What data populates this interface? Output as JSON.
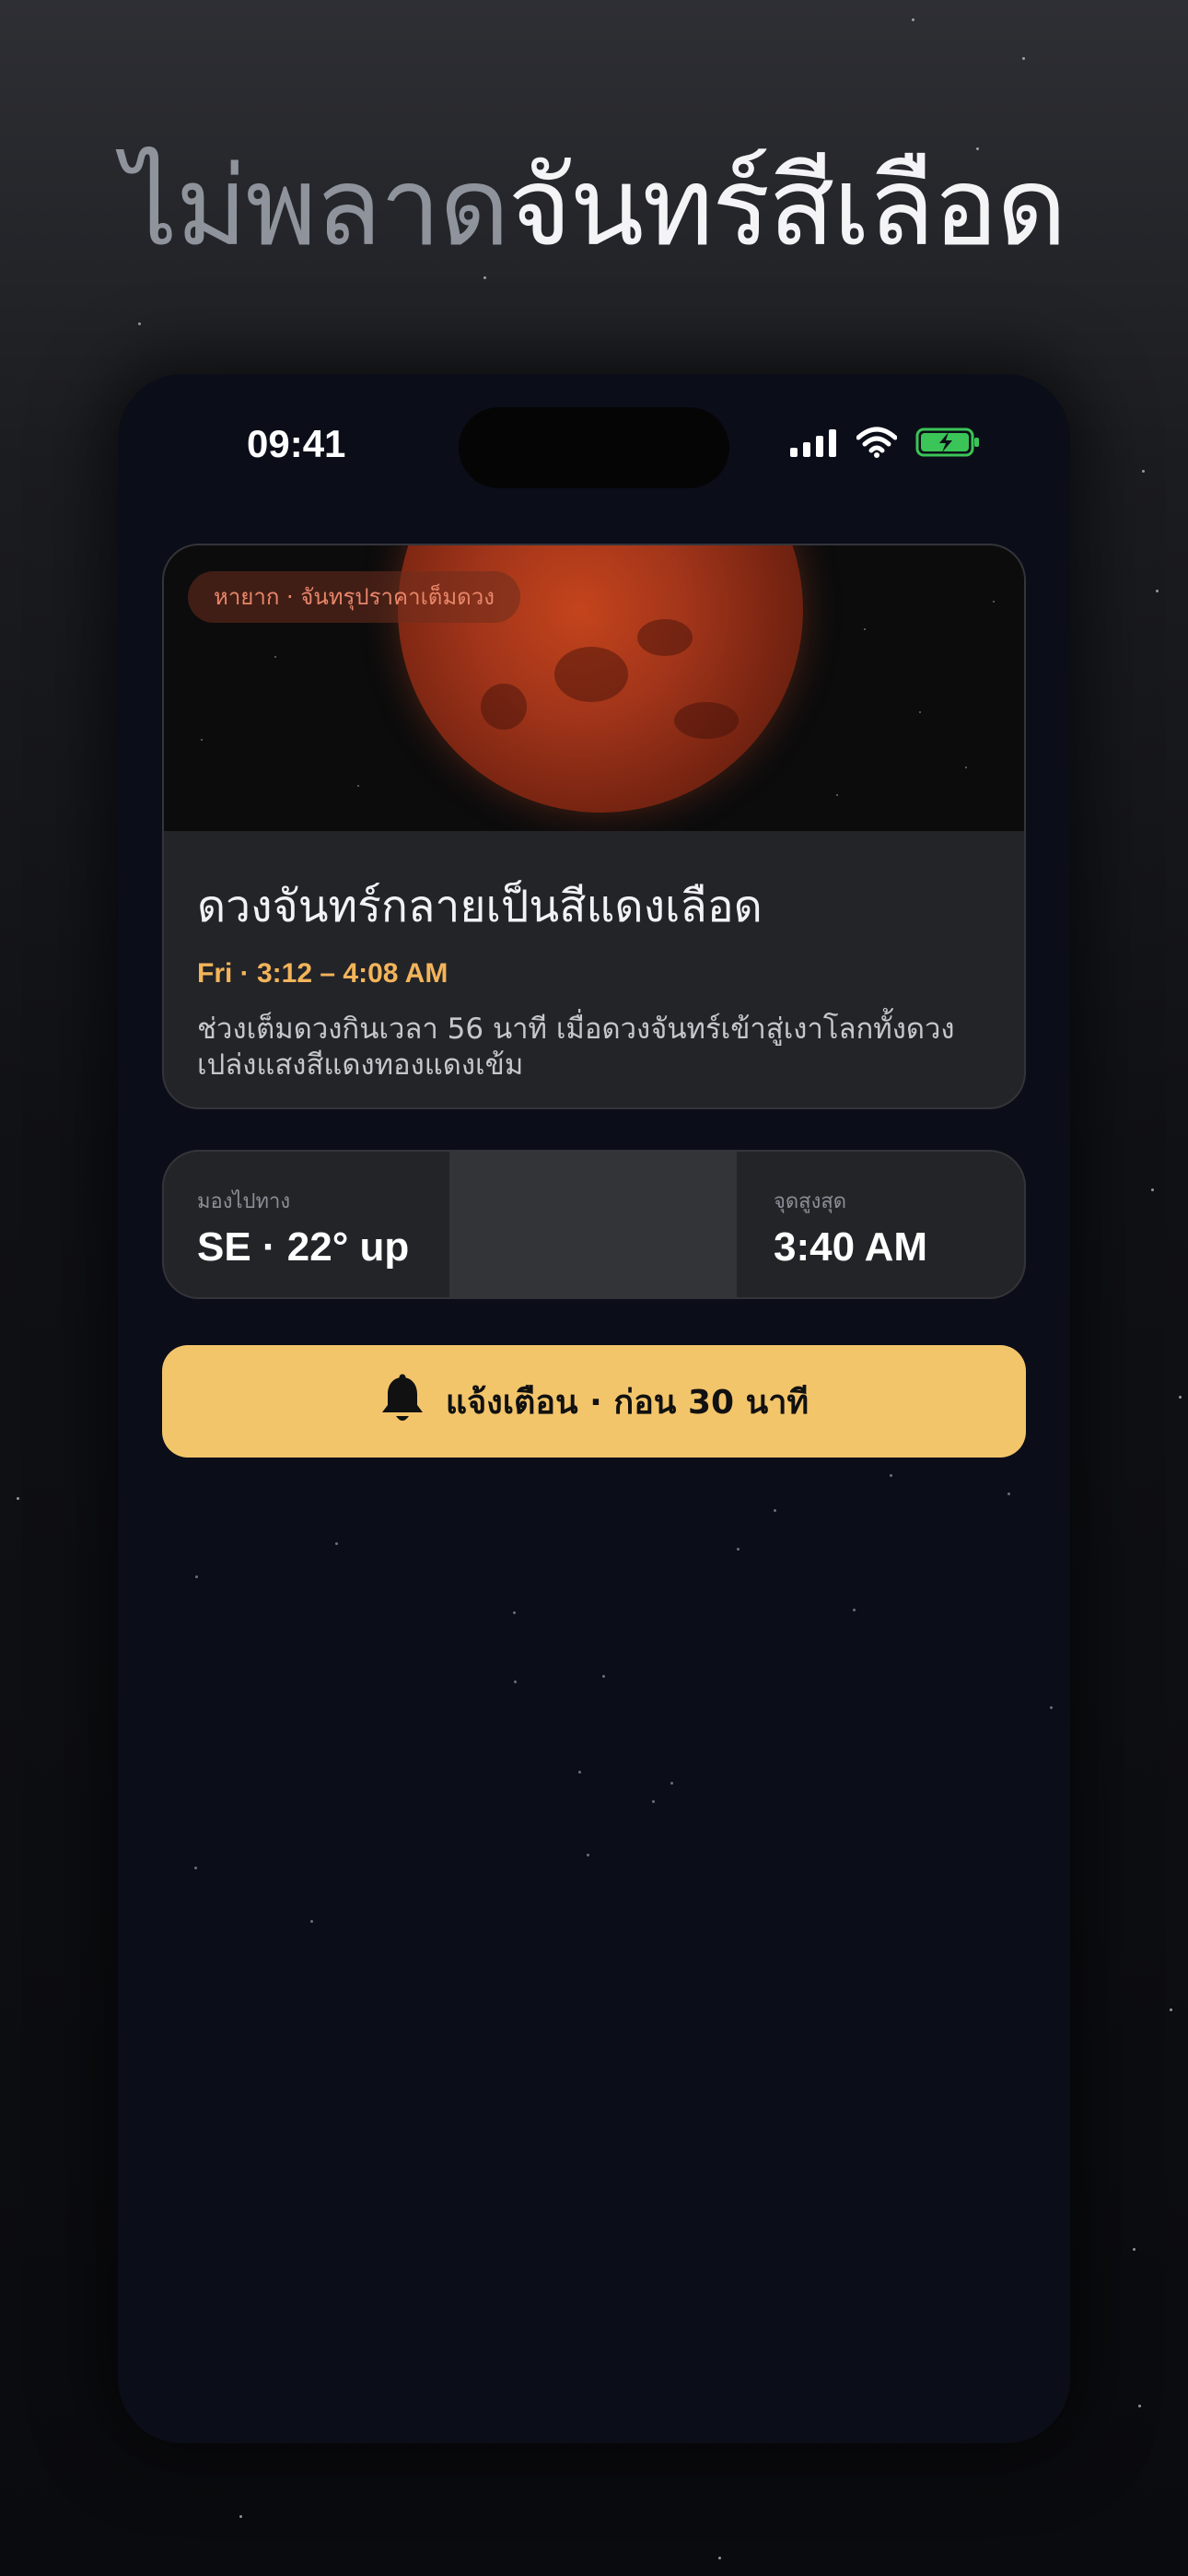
{
  "headline": {
    "muted": "ไม่พลาด",
    "bright": "จันทร์สีเลือด"
  },
  "status_bar": {
    "time": "09:41",
    "icons": [
      "cellular-signal-icon",
      "wifi-icon",
      "battery-charging-icon"
    ]
  },
  "event_card": {
    "tag": "หายาก · จันทรุปราคาเต็มดวง",
    "title": "ดวงจันทร์กลายเป็นสีแดงเลือด",
    "time": "Fri · 3:12 – 4:08 AM",
    "description": "ช่วงเต็มดวงกินเวลา 56 นาที เมื่อดวงจันทร์เข้าสู่เงาโลกทั้งดวง เปล่งแสงสีแดงทองแดงเข้ม"
  },
  "info_row": {
    "direction_label": "มองไปทาง",
    "direction_value": "SE · 22° up",
    "peak_label": "จุดสูงสุด",
    "peak_value": "3:40 AM"
  },
  "alert_button": {
    "label": "แจ้งเตือน · ก่อน 30 นาที",
    "icon": "bell-icon"
  },
  "colors": {
    "accent_gold": "#f3c56b",
    "time_orange": "#f3b45a",
    "tag_text": "#e8866a",
    "battery_green": "#3bc457"
  }
}
